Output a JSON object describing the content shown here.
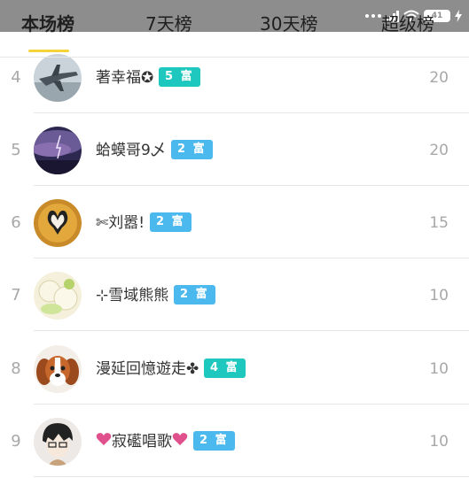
{
  "status_bar": {
    "battery": "41"
  },
  "tabs": [
    {
      "label": "本场榜",
      "active": true
    },
    {
      "label": "7天榜",
      "active": false
    },
    {
      "label": "30天榜",
      "active": false
    },
    {
      "label": "超级榜",
      "active": false
    }
  ],
  "rankings": [
    {
      "rank": "4",
      "name": "著幸福✪",
      "badge_level": "5",
      "badge_text": "富",
      "badge_color": "#1ec8bf",
      "score": "20",
      "avatar": "fighter-jet-avatar"
    },
    {
      "rank": "5",
      "name": "蛤蟆哥9乄",
      "badge_level": "2",
      "badge_text": "富",
      "badge_color": "#4bb8ee",
      "score": "20",
      "avatar": "storm-sky-avatar"
    },
    {
      "rank": "6",
      "name": "✄刘嚣!",
      "badge_level": "2",
      "badge_text": "富",
      "badge_color": "#4bb8ee",
      "score": "15",
      "avatar": "swans-heart-avatar"
    },
    {
      "rank": "7",
      "name": "⊹雪域熊熊",
      "badge_level": "2",
      "badge_text": "富",
      "badge_color": "#4bb8ee",
      "score": "10",
      "avatar": "cream-cake-avatar"
    },
    {
      "rank": "8",
      "name": "漫延回憶遊走✤",
      "badge_level": "4",
      "badge_text": "富",
      "badge_color": "#1ec8bf",
      "score": "10",
      "avatar": "puppy-avatar"
    },
    {
      "rank": "9",
      "name": "寂礷唱歌",
      "badge_level": "2",
      "badge_text": "富",
      "badge_color": "#4bb8ee",
      "score": "10",
      "avatar": "anime-boy-avatar"
    }
  ]
}
